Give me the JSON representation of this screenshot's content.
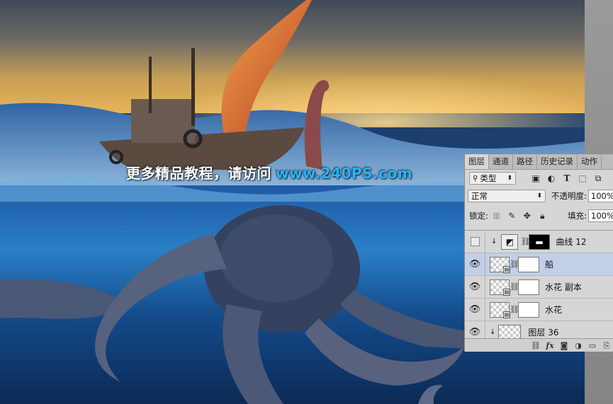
{
  "watermark": {
    "text": "更多精品教程，请访问",
    "site": "www.240PS.com"
  },
  "colors": {
    "accent_blue": "#27b5ff",
    "selected_row": "#c2cfe7",
    "panel_bg": "#d6d6d6"
  },
  "panel": {
    "tabs": [
      {
        "label": "图层",
        "active": true
      },
      {
        "label": "通道",
        "active": false
      },
      {
        "label": "路径",
        "active": false
      },
      {
        "label": "历史记录",
        "active": false
      },
      {
        "label": "动作",
        "active": false
      }
    ],
    "filter": {
      "label": "类型",
      "icons": [
        "image-filter-icon",
        "adjustment-filter-icon",
        "type-filter-icon",
        "shape-filter-icon",
        "smart-object-filter-icon"
      ],
      "type_glyph": "T"
    },
    "blend_mode": "正常",
    "opacity": {
      "label": "不透明度:",
      "value": "100%"
    },
    "lock": {
      "label": "锁定:"
    },
    "fill": {
      "label": "填充:",
      "value": "100%"
    },
    "layers": [
      {
        "name": "曲线 12",
        "visible": false,
        "clipped": true,
        "type": "adjustment",
        "selected": false
      },
      {
        "name": "船",
        "visible": true,
        "clipped": false,
        "type": "smart-object",
        "selected": true
      },
      {
        "name": "水花 副本",
        "visible": true,
        "clipped": false,
        "type": "smart-object",
        "selected": false
      },
      {
        "name": "水花",
        "visible": true,
        "clipped": false,
        "type": "smart-object",
        "selected": false
      },
      {
        "name": "图层 36",
        "visible": true,
        "clipped": true,
        "type": "pixel",
        "selected": false
      }
    ],
    "footer_icons": [
      "link-layers-icon",
      "fx-icon",
      "add-mask-icon",
      "adjustment-layer-icon",
      "new-group-icon",
      "new-layer-icon"
    ],
    "footer_fx": "fx"
  }
}
